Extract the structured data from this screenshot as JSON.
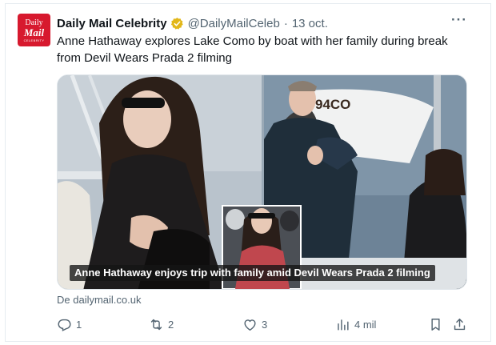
{
  "account": {
    "avatar_text_top": "Daily",
    "avatar_text_main": "Mail",
    "avatar_text_small": "CELEBRITY",
    "name": "Daily Mail Celebrity",
    "handle": "@DailyMailCeleb",
    "separator": "·",
    "date": "13 oct."
  },
  "more_label": "···",
  "tweet": {
    "text": "Anne Hathaway explores Lake Como by boat with her family during break from Devil Wears Prada 2 filming"
  },
  "card": {
    "caption": "Anne Hathaway enjoys trip with family amid Devil Wears Prada 2 filming",
    "boat_lettering": "94CO",
    "source": "De dailymail.co.uk"
  },
  "actions": {
    "replies": "1",
    "reposts": "2",
    "likes": "3",
    "views": "4 mil"
  },
  "colors": {
    "brand_red": "#d7192e",
    "verified_gold": "#e2b719",
    "muted_text": "#536471"
  }
}
